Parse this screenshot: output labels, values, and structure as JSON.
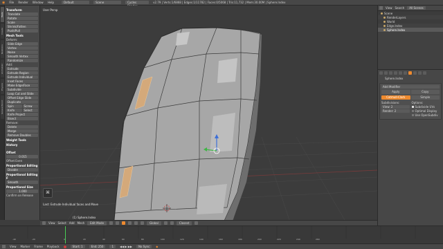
{
  "topbar": {
    "menu": [
      "File",
      "Render",
      "Window",
      "Help"
    ],
    "layout": "Default",
    "scene": "Scene",
    "engine": "Cycles Render",
    "stats": "v2.79 | Verts:1/6868 | Edges:1/11782 | Faces:0/5068 | Tris:11,732 | Mem:30.00M | Sphere.Index"
  },
  "tabs": [
    "Tools",
    "Create",
    "Relations",
    "Animation",
    "Physics",
    "Grease Pencil"
  ],
  "tools": {
    "transform_header": "Transform",
    "transform": [
      "Translate",
      "Rotate",
      "Scale",
      "Shrink/Fatten",
      "Push/Pull"
    ],
    "mesh_tools_header": "Mesh Tools",
    "deform_header": "Deform:",
    "deform": [
      "Slide Edge",
      "Vertex",
      "Noise",
      "Smooth Vertex",
      "Randomize"
    ],
    "add_header": "Add:",
    "add": [
      "Extrude",
      "Extrude Region",
      "Extrude Individual",
      "Inset Faces",
      "Make Edge/Face",
      "Subdivide",
      "Loop Cut and Slide",
      "Offset Edge Slide",
      "Duplicate"
    ],
    "spin_row": [
      "Spin",
      "Screw"
    ],
    "knife_row": [
      "Knife",
      "Select"
    ],
    "add_tail": [
      "Knife Project",
      "Bisect"
    ],
    "remove_header": "Remove:",
    "remove": [
      "Delete",
      "Merge",
      "Remove Doubles"
    ],
    "weight": "Weight Tools",
    "history": "History",
    "offset_header": "Offset",
    "offset_value": "0.015",
    "offset_even": "Offset Even",
    "prop_header": "Proportional Editing",
    "prop_value": "Disable",
    "falloff_header": "Proportional Editing F",
    "falloff_value": "Smooth",
    "size_header": "Proportional Size",
    "size_value": "1.000",
    "edge_slide": "Confirm on Release"
  },
  "viewport": {
    "title": "User Persp",
    "status": "Last: Extrude Individual faces and Move",
    "object": "(1) Sphere.Index",
    "hint_key": "⌘"
  },
  "vpheader": {
    "menu": [
      "View",
      "Select",
      "Add",
      "Mesh"
    ],
    "mode": "Edit Mode",
    "pivot": "Global",
    "snap": "Closest"
  },
  "outliner": {
    "head": [
      "View",
      "Search",
      "All Scenes"
    ],
    "rows": [
      "Scene",
      "RenderLayers",
      "World",
      "Edge.Index",
      "Sphere.Index"
    ]
  },
  "props": {
    "object": "Sphere.Index",
    "section": "Add Modifier",
    "tabs": [
      "Apply",
      "Copy"
    ],
    "subtabs": [
      "Catmull-Clark",
      "Simple"
    ],
    "subdiv_label": "Subdivisions:",
    "options_label": "Options:",
    "view": "View:  2",
    "render": "Render:  2",
    "opts": [
      "Subdivide UVs",
      "Optimal Display",
      "Use OpenSubdiv"
    ]
  },
  "timeline": {
    "menu": [
      "View",
      "Marker",
      "Frame",
      "Playback"
    ],
    "start": "Start: 1",
    "end": "End: 250",
    "frame": "1",
    "sync": "No Sync",
    "ticks": [
      "-40",
      "-20",
      "0",
      "20",
      "40",
      "60",
      "80",
      "100",
      "120",
      "140",
      "160",
      "180",
      "200",
      "220",
      "240",
      "260"
    ]
  },
  "colors": {
    "accent": "#ee8a2f",
    "timeline_cursor": "#49d055",
    "viewport_bg": "#3c3c3c",
    "mesh_face": "#a6a6a6",
    "selected_face": "#d4a97a"
  }
}
